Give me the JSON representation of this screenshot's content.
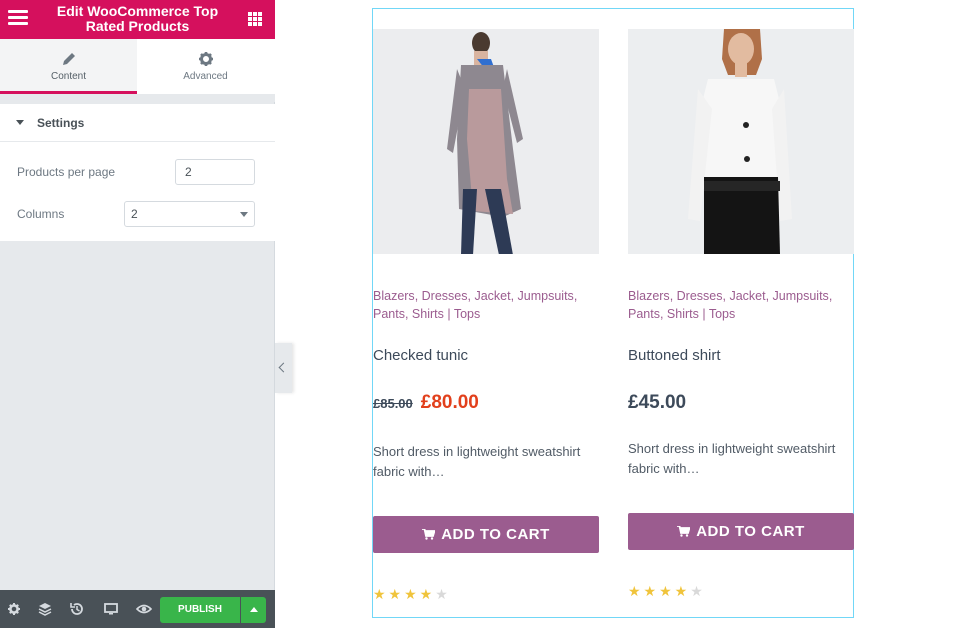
{
  "panel": {
    "title": "Edit WooCommerce Top Rated Products",
    "tabs": [
      {
        "label": "Content",
        "icon": "pencil-icon"
      },
      {
        "label": "Advanced",
        "icon": "gear-icon"
      }
    ],
    "section_title": "Settings",
    "products_per_page": {
      "label": "Products per page",
      "value": "2"
    },
    "columns": {
      "label": "Columns",
      "value": "2"
    },
    "footer": {
      "publish_label": "PUBLISH"
    }
  },
  "colors": {
    "brand": "#d5105d",
    "publish": "#39b54a",
    "accent": "#9b5c8f",
    "sale": "#e2401c",
    "star": "#f0c43c"
  },
  "products": [
    {
      "categories": [
        "Blazers",
        "Dresses",
        "Jacket",
        "Jumpsuits",
        "Pants",
        "Shirts"
      ],
      "tag": "Tops",
      "title": "Checked tunic",
      "price_old": "£85.00",
      "price": "£80.00",
      "description": "Short dress in lightweight sweatshirt fabric with…",
      "button": "ADD TO CART",
      "rating": 4,
      "rating_max": 5
    },
    {
      "categories": [
        "Blazers",
        "Dresses",
        "Jacket",
        "Jumpsuits",
        "Pants",
        "Shirts"
      ],
      "tag": "Tops",
      "title": "Buttoned shirt",
      "price_old": "",
      "price": "£45.00",
      "description": "Short dress in lightweight sweatshirt fabric with…",
      "button": "ADD TO CART",
      "rating": 4,
      "rating_max": 5
    }
  ]
}
